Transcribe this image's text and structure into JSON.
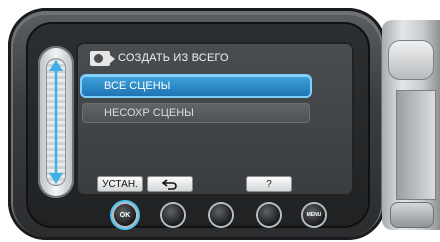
{
  "menu": {
    "title": "СОЗДАТЬ ИЗ ВСЕГО",
    "items": [
      {
        "label": "ВСЕ СЦЕНЫ",
        "selected": true
      },
      {
        "label": "НЕСОХР СЦЕНЫ",
        "selected": false
      }
    ]
  },
  "softkeys": {
    "set_label": "УСТАН.",
    "back_icon": "return-arrow-icon",
    "help_label": "?"
  },
  "buttons": {
    "ok_label": "OK",
    "menu_label": "MENU"
  },
  "colors": {
    "selection": "#2a88c8",
    "highlight_ring": "#4ec4f2"
  }
}
